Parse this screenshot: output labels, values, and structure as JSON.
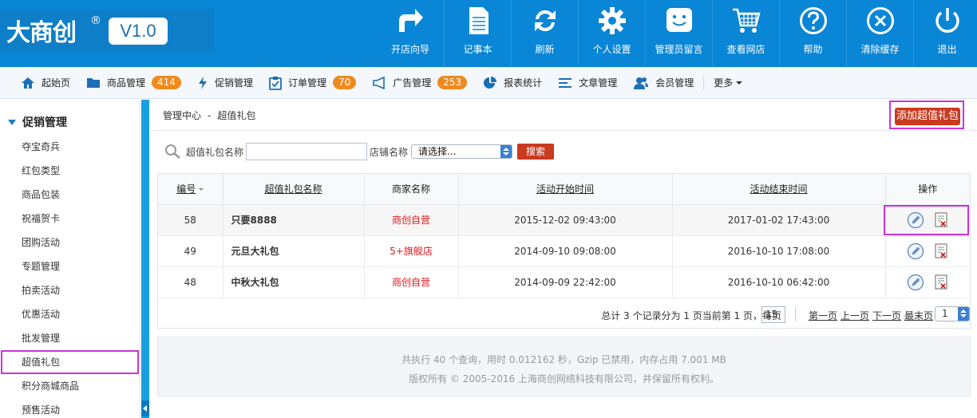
{
  "brand": {
    "name": "大商创",
    "reg": "®",
    "version": "V1.0"
  },
  "top_nav": [
    {
      "label": "开店向导",
      "icon": "share-arrow-icon"
    },
    {
      "label": "记事本",
      "icon": "notepad-icon"
    },
    {
      "label": "刷新",
      "icon": "refresh-icon"
    },
    {
      "label": "个人设置",
      "icon": "gear-icon"
    },
    {
      "label": "管理员留言",
      "icon": "smiley-message-icon"
    },
    {
      "label": "查看网店",
      "icon": "cart-icon"
    },
    {
      "label": "帮助",
      "icon": "help-icon"
    },
    {
      "label": "清除缓存",
      "icon": "clear-cache-icon"
    },
    {
      "label": "退出",
      "icon": "power-icon"
    }
  ],
  "nav": {
    "home": "起始页",
    "goods": "商品管理",
    "goods_count": "414",
    "promo": "促销管理",
    "orders": "订单管理",
    "orders_count": "70",
    "ads": "广告管理",
    "ads_count": "253",
    "reports": "报表统计",
    "articles": "文章管理",
    "members": "会员管理",
    "more": "更多"
  },
  "sidebar": {
    "title": "促销管理",
    "items": [
      "夺宝奇兵",
      "红包类型",
      "商品包装",
      "祝福贺卡",
      "团购活动",
      "专题管理",
      "拍卖活动",
      "优惠活动",
      "批发管理",
      "超值礼包",
      "积分商城商品",
      "预售活动"
    ],
    "active_index": 9
  },
  "breadcrumb": {
    "root": "管理中心",
    "sep": "-",
    "current": "超值礼包"
  },
  "add_button": "添加超值礼包",
  "search": {
    "name_label": "超值礼包名称",
    "name_value": "",
    "shop_label": "店铺名称",
    "shop_select": "请选择...",
    "button": "搜索"
  },
  "table": {
    "headers": {
      "id": "编号",
      "name": "超值礼包名称",
      "shop": "商家名称",
      "start": "活动开始时间",
      "end": "活动结束时间",
      "ops": "操作"
    },
    "rows": [
      {
        "id": "58",
        "name": "只要8888",
        "shop": "商创自营",
        "start": "2015-12-02 09:43:00",
        "end": "2017-01-02 17:43:00"
      },
      {
        "id": "49",
        "name": "元旦大礼包",
        "shop": "5+旗舰店",
        "start": "2014-09-10 09:08:00",
        "end": "2016-10-10 17:08:00"
      },
      {
        "id": "48",
        "name": "中秋大礼包",
        "shop": "商创自营",
        "start": "2014-09-09 22:42:00",
        "end": "2016-10-10 06:42:00"
      }
    ]
  },
  "pager": {
    "info": "总计 3 个记录分为 1 页当前第 1 页，每页",
    "per_page": "15",
    "first": "第一页",
    "prev": "上一页",
    "next": "下一页",
    "last": "最末页",
    "page": "1"
  },
  "footer": {
    "line1": "共执行 40 个查询，用时 0.012162 秒，Gzip 已禁用，内存占用 7.001 MB",
    "line2": "版权所有 © 2005-2016 上海商创网络科技有限公司，并保留所有权利。"
  },
  "colors": {
    "header_blue": "#0a86d6",
    "accent_red": "#c93a1f",
    "badge_orange": "#f08a1c",
    "highlight_purple": "#cc33dd",
    "shop_red": "#e0161b"
  }
}
